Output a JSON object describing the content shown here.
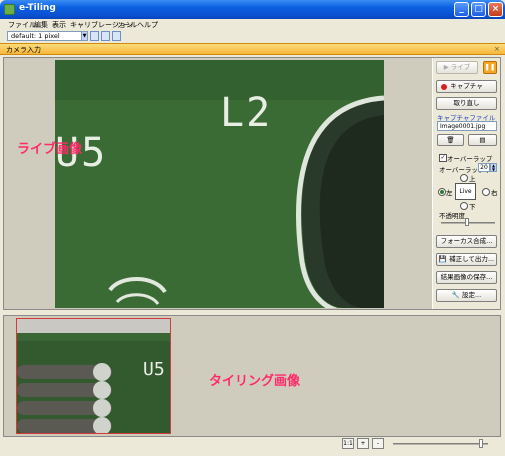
{
  "window": {
    "title": "e-Tiling"
  },
  "menu": {
    "items": [
      "ファイル",
      "編集",
      "表示",
      "キャリブレーション",
      "ツール",
      "ヘルプ"
    ]
  },
  "toolbar": {
    "preset_value": "default: 1 pixel"
  },
  "panel": {
    "title": "カメラ入力",
    "close": "×"
  },
  "live": {
    "label": "ライブ画像",
    "pcb_text": {
      "u5": "U5",
      "l2": "L2"
    }
  },
  "controls": {
    "live_button": "ライブ",
    "pause_icon": "pause-icon",
    "capture_button": "キャプチャ",
    "redo_button": "取り直し",
    "capture_file_label": "キャプチャファイル",
    "capture_file_value": "Image0001.jpg",
    "overlap_checkbox": "オーバーラップ",
    "overlap_checked": true,
    "overlap_rate_label": "オーバーラップ率",
    "overlap_rate_value": "20",
    "dir_up": "上",
    "dir_live": "Live",
    "dir_left": "左",
    "dir_right": "右",
    "dir_down": "下",
    "dir_selected": "left",
    "transparency_label": "不透明度",
    "focus_button": "フォーカス合成...",
    "correct_output_button": "補正して出力...",
    "save_result_button": "結果画像の保存...",
    "settings_button": "設定..."
  },
  "tiling": {
    "label": "タイリング画像",
    "pcb_text": "U5"
  },
  "status": {
    "zoom_buttons": [
      "1:1",
      "+",
      "-"
    ],
    "zoom_level_fraction": 0.95
  },
  "colors": {
    "annotation": "#ff2a6a",
    "titlebar": "#0a5fe0",
    "panel_header": "#f6b73a",
    "pcb_green": "#3d7038"
  }
}
